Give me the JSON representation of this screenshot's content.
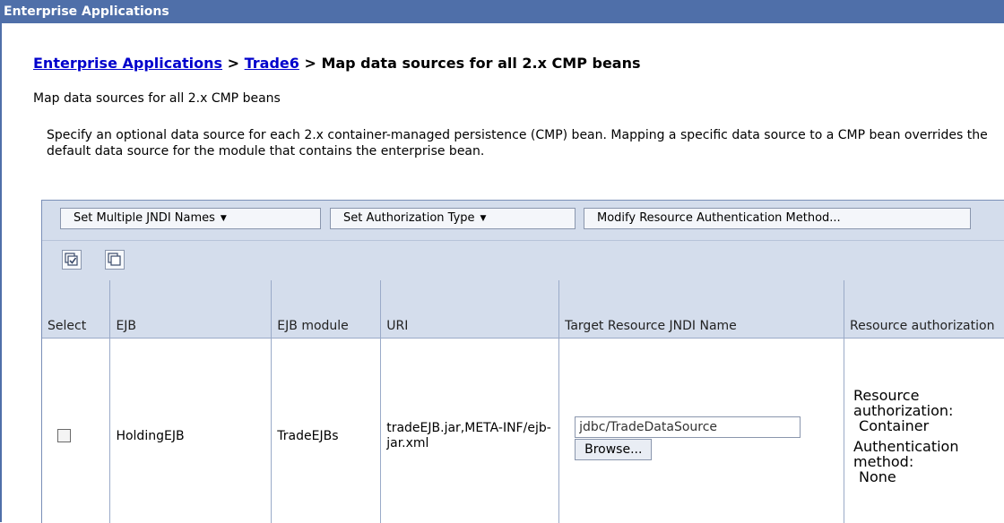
{
  "window": {
    "title": "Enterprise Applications"
  },
  "breadcrumb": {
    "link1": "Enterprise Applications",
    "sep1": " > ",
    "link2": "Trade6",
    "sep2": " > ",
    "current": "Map data sources for all 2.x CMP beans"
  },
  "subtitle": "Map data sources for all 2.x CMP beans",
  "description": "Specify an optional data source for each 2.x container-managed persistence (CMP) bean. Mapping a specific data source to a CMP bean overrides the default data source for the module that contains the enterprise bean.",
  "toolbar": {
    "set_jndi": "Set Multiple JNDI Names",
    "set_auth": "Set Authorization Type",
    "modify_auth": "Modify Resource Authentication Method..."
  },
  "icons": {
    "select_all": "select-all-icon",
    "deselect_all": "deselect-all-icon"
  },
  "table": {
    "headers": {
      "select": "Select",
      "ejb": "EJB",
      "ejb_module": "EJB module",
      "uri": "URI",
      "jndi": "Target Resource JNDI Name",
      "res_auth": "Resource authorization"
    },
    "rows": [
      {
        "selected": false,
        "ejb": "HoldingEJB",
        "ejb_module": "TradeEJBs",
        "uri": "tradeEJB.jar,META-INF/ejb-jar.xml",
        "jndi_value": "jdbc/TradeDataSource",
        "browse_label": "Browse...",
        "res_auth_label": "Resource authorization:",
        "res_auth_value": "Container",
        "auth_method_label": "Authentication method:",
        "auth_method_value": "None"
      }
    ]
  }
}
